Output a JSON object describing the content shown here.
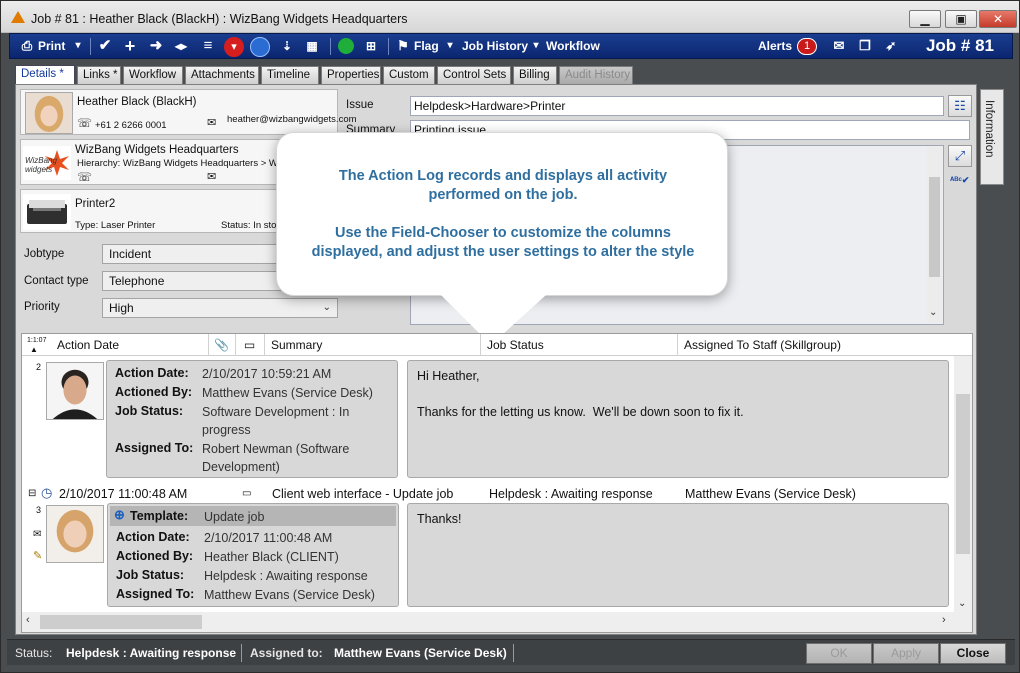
{
  "window": {
    "title": "Job # 81 : Heather Black (BlackH) : WizBang Widgets Headquarters",
    "minimize": "▁",
    "maximize": "▣",
    "close": "✕"
  },
  "toolbar": {
    "print": "Print",
    "flag": "Flag",
    "job_history": "Job History",
    "workflow": "Workflow",
    "alerts": "Alerts",
    "alerts_count": "1",
    "job_number": "Job # 81"
  },
  "tabs": [
    {
      "label": "Details *",
      "state": "active"
    },
    {
      "label": "Links *",
      "state": "normal"
    },
    {
      "label": "Workflow",
      "state": "normal"
    },
    {
      "label": "Attachments",
      "state": "normal"
    },
    {
      "label": "Timeline",
      "state": "normal"
    },
    {
      "label": "Properties",
      "state": "normal"
    },
    {
      "label": "Custom",
      "state": "normal"
    },
    {
      "label": "Control Sets",
      "state": "normal"
    },
    {
      "label": "Billing",
      "state": "normal"
    },
    {
      "label": "Audit History",
      "state": "disabled"
    }
  ],
  "side_panel": {
    "information": "Information"
  },
  "client": {
    "name": "Heather Black (BlackH)",
    "phone": "+61 2 6266 0001",
    "email": "heather@wizbangwidgets.com"
  },
  "site": {
    "name": "WizBang Widgets Headquarters",
    "hierarchy": "Hierarchy:  WizBang  Widgets  Headquarters  >  W",
    "logo_text": "WizBang widgets"
  },
  "asset": {
    "name": "Printer2",
    "type": "Type: Laser Printer",
    "status": "Status: In sto"
  },
  "form": {
    "jobtype_label": "Jobtype",
    "jobtype_value": "Incident",
    "contacttype_label": "Contact type",
    "contacttype_value": "Telephone",
    "priority_label": "Priority",
    "priority_value": "High",
    "issue_label": "Issue",
    "issue_value": "Helpdesk>Hardware>Printer",
    "summary_label": "Summary",
    "summary_value": "Printing issue"
  },
  "callout": {
    "line1": "The Action Log records and displays all activity",
    "line2": "performed on the job.",
    "line3": "Use the Field-Chooser to customize the columns",
    "line4": "displayed, and adjust the user settings to alter the style"
  },
  "grid": {
    "sort_tag": "1:1:07",
    "headers": {
      "action_date": "Action Date",
      "summary": "Summary",
      "job_status": "Job Status",
      "assigned_to": "Assigned To Staff (Skillgroup)"
    },
    "entries": [
      {
        "num": "2",
        "action_date_label": "Action Date:",
        "action_date": "2/10/2017 10:59:21 AM",
        "actioned_by_label": "Actioned By:",
        "actioned_by": "Matthew Evans (Service Desk)",
        "job_status_label": "Job Status:",
        "job_status": "Software Development : In progress",
        "assigned_to_label": "Assigned To:",
        "assigned_to": "Robert Newman (Software Development)",
        "message": "Hi Heather,\n\nThanks for the letting us know.  We'll be down soon to fix it."
      },
      {
        "num": "3",
        "group_date": "2/10/2017 11:00:48 AM",
        "group_summary": "Client web interface - Update job",
        "group_status": "Helpdesk : Awaiting response",
        "group_assigned": "Matthew Evans (Service Desk)",
        "template_label": "Template:",
        "template": "Update job",
        "action_date_label": "Action Date:",
        "action_date": "2/10/2017 11:00:48 AM",
        "actioned_by_label": "Actioned By:",
        "actioned_by": "Heather Black (CLIENT)",
        "job_status_label": "Job Status:",
        "job_status": "Helpdesk : Awaiting response",
        "assigned_to_label": "Assigned To:",
        "assigned_to": "Matthew Evans (Service Desk)",
        "message": "Thanks!"
      }
    ]
  },
  "statusbar": {
    "status_label": "Status:",
    "status_value": "Helpdesk : Awaiting response",
    "assigned_label": "Assigned to:",
    "assigned_value": "Matthew Evans (Service Desk)",
    "ok": "OK",
    "apply": "Apply",
    "close": "Close"
  }
}
